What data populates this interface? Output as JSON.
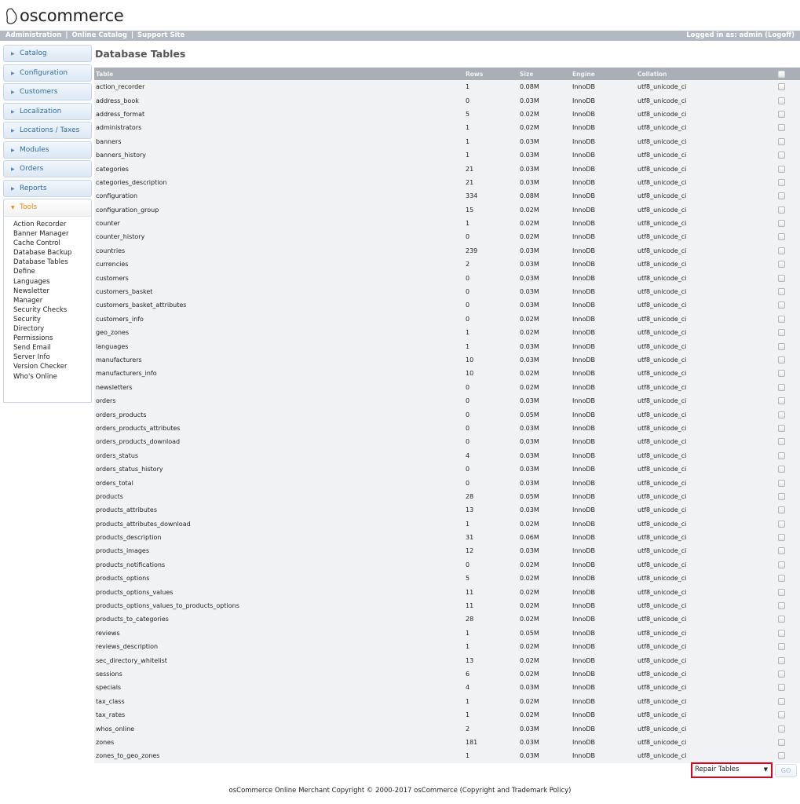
{
  "app": {
    "logo_text": "oscommerce"
  },
  "header": {
    "links": [
      "Administration",
      "Online Catalog",
      "Support Site"
    ],
    "separator": "|",
    "logged_in": "Logged in as: admin (Logoff)"
  },
  "sidebar": {
    "items": [
      {
        "label": "Catalog"
      },
      {
        "label": "Configuration"
      },
      {
        "label": "Customers"
      },
      {
        "label": "Localization"
      },
      {
        "label": "Locations / Taxes"
      },
      {
        "label": "Modules"
      },
      {
        "label": "Orders"
      },
      {
        "label": "Reports"
      },
      {
        "label": "Tools"
      }
    ],
    "tools_sub": [
      "Action Recorder",
      "Banner Manager",
      "Cache Control",
      "Database Backup",
      "Database Tables",
      "Define",
      "Languages",
      "Newsletter",
      "Manager",
      "Security Checks",
      "Security",
      "Directory",
      "Permissions",
      "Send Email",
      "Server Info",
      "Version Checker",
      "Who's Online"
    ]
  },
  "main": {
    "title": "Database Tables",
    "columns": [
      "Table",
      "Rows",
      "Size",
      "Engine",
      "Collation"
    ],
    "rows": [
      [
        "action_recorder",
        "1",
        "0.08M",
        "InnoDB",
        "utf8_unicode_ci"
      ],
      [
        "address_book",
        "0",
        "0.03M",
        "InnoDB",
        "utf8_unicode_ci"
      ],
      [
        "address_format",
        "5",
        "0.02M",
        "InnoDB",
        "utf8_unicode_ci"
      ],
      [
        "administrators",
        "1",
        "0.02M",
        "InnoDB",
        "utf8_unicode_ci"
      ],
      [
        "banners",
        "1",
        "0.03M",
        "InnoDB",
        "utf8_unicode_ci"
      ],
      [
        "banners_history",
        "1",
        "0.03M",
        "InnoDB",
        "utf8_unicode_ci"
      ],
      [
        "categories",
        "21",
        "0.03M",
        "InnoDB",
        "utf8_unicode_ci"
      ],
      [
        "categories_description",
        "21",
        "0.03M",
        "InnoDB",
        "utf8_unicode_ci"
      ],
      [
        "configuration",
        "334",
        "0.08M",
        "InnoDB",
        "utf8_unicode_ci"
      ],
      [
        "configuration_group",
        "15",
        "0.02M",
        "InnoDB",
        "utf8_unicode_ci"
      ],
      [
        "counter",
        "1",
        "0.02M",
        "InnoDB",
        "utf8_unicode_ci"
      ],
      [
        "counter_history",
        "0",
        "0.02M",
        "InnoDB",
        "utf8_unicode_ci"
      ],
      [
        "countries",
        "239",
        "0.03M",
        "InnoDB",
        "utf8_unicode_ci"
      ],
      [
        "currencies",
        "2",
        "0.03M",
        "InnoDB",
        "utf8_unicode_ci"
      ],
      [
        "customers",
        "0",
        "0.03M",
        "InnoDB",
        "utf8_unicode_ci"
      ],
      [
        "customers_basket",
        "0",
        "0.03M",
        "InnoDB",
        "utf8_unicode_ci"
      ],
      [
        "customers_basket_attributes",
        "0",
        "0.03M",
        "InnoDB",
        "utf8_unicode_ci"
      ],
      [
        "customers_info",
        "0",
        "0.02M",
        "InnoDB",
        "utf8_unicode_ci"
      ],
      [
        "geo_zones",
        "1",
        "0.02M",
        "InnoDB",
        "utf8_unicode_ci"
      ],
      [
        "languages",
        "1",
        "0.03M",
        "InnoDB",
        "utf8_unicode_ci"
      ],
      [
        "manufacturers",
        "10",
        "0.03M",
        "InnoDB",
        "utf8_unicode_ci"
      ],
      [
        "manufacturers_info",
        "10",
        "0.02M",
        "InnoDB",
        "utf8_unicode_ci"
      ],
      [
        "newsletters",
        "0",
        "0.02M",
        "InnoDB",
        "utf8_unicode_ci"
      ],
      [
        "orders",
        "0",
        "0.03M",
        "InnoDB",
        "utf8_unicode_ci"
      ],
      [
        "orders_products",
        "0",
        "0.05M",
        "InnoDB",
        "utf8_unicode_ci"
      ],
      [
        "orders_products_attributes",
        "0",
        "0.03M",
        "InnoDB",
        "utf8_unicode_ci"
      ],
      [
        "orders_products_download",
        "0",
        "0.03M",
        "InnoDB",
        "utf8_unicode_ci"
      ],
      [
        "orders_status",
        "4",
        "0.03M",
        "InnoDB",
        "utf8_unicode_ci"
      ],
      [
        "orders_status_history",
        "0",
        "0.03M",
        "InnoDB",
        "utf8_unicode_ci"
      ],
      [
        "orders_total",
        "0",
        "0.03M",
        "InnoDB",
        "utf8_unicode_ci"
      ],
      [
        "products",
        "28",
        "0.05M",
        "InnoDB",
        "utf8_unicode_ci"
      ],
      [
        "products_attributes",
        "13",
        "0.03M",
        "InnoDB",
        "utf8_unicode_ci"
      ],
      [
        "products_attributes_download",
        "1",
        "0.02M",
        "InnoDB",
        "utf8_unicode_ci"
      ],
      [
        "products_description",
        "31",
        "0.06M",
        "InnoDB",
        "utf8_unicode_ci"
      ],
      [
        "products_images",
        "12",
        "0.03M",
        "InnoDB",
        "utf8_unicode_ci"
      ],
      [
        "products_notifications",
        "0",
        "0.02M",
        "InnoDB",
        "utf8_unicode_ci"
      ],
      [
        "products_options",
        "5",
        "0.02M",
        "InnoDB",
        "utf8_unicode_ci"
      ],
      [
        "products_options_values",
        "11",
        "0.02M",
        "InnoDB",
        "utf8_unicode_ci"
      ],
      [
        "products_options_values_to_products_options",
        "11",
        "0.02M",
        "InnoDB",
        "utf8_unicode_ci"
      ],
      [
        "products_to_categories",
        "28",
        "0.02M",
        "InnoDB",
        "utf8_unicode_ci"
      ],
      [
        "reviews",
        "1",
        "0.05M",
        "InnoDB",
        "utf8_unicode_ci"
      ],
      [
        "reviews_description",
        "1",
        "0.02M",
        "InnoDB",
        "utf8_unicode_ci"
      ],
      [
        "sec_directory_whitelist",
        "13",
        "0.02M",
        "InnoDB",
        "utf8_unicode_ci"
      ],
      [
        "sessions",
        "6",
        "0.02M",
        "InnoDB",
        "utf8_unicode_ci"
      ],
      [
        "specials",
        "4",
        "0.03M",
        "InnoDB",
        "utf8_unicode_ci"
      ],
      [
        "tax_class",
        "1",
        "0.02M",
        "InnoDB",
        "utf8_unicode_ci"
      ],
      [
        "tax_rates",
        "1",
        "0.02M",
        "InnoDB",
        "utf8_unicode_ci"
      ],
      [
        "whos_online",
        "2",
        "0.03M",
        "InnoDB",
        "utf8_unicode_ci"
      ],
      [
        "zones",
        "181",
        "0.03M",
        "InnoDB",
        "utf8_unicode_ci"
      ],
      [
        "zones_to_geo_zones",
        "1",
        "0.03M",
        "InnoDB",
        "utf8_unicode_ci"
      ]
    ],
    "action": {
      "selected": "Repair Tables",
      "go_label": "GO"
    }
  },
  "footer": {
    "prefix": "osCommerce Online Merchant Copyright © 2000-2017",
    "brand": "osCommerce",
    "link": "(Copyright and Trademark Policy)"
  },
  "colors": {
    "accent_active": "#e8870d",
    "link_blue": "#2e6ea6",
    "header_bar": "#b3b9c2",
    "table_header": "#a9aeb7",
    "highlight_red": "#e3001b"
  }
}
